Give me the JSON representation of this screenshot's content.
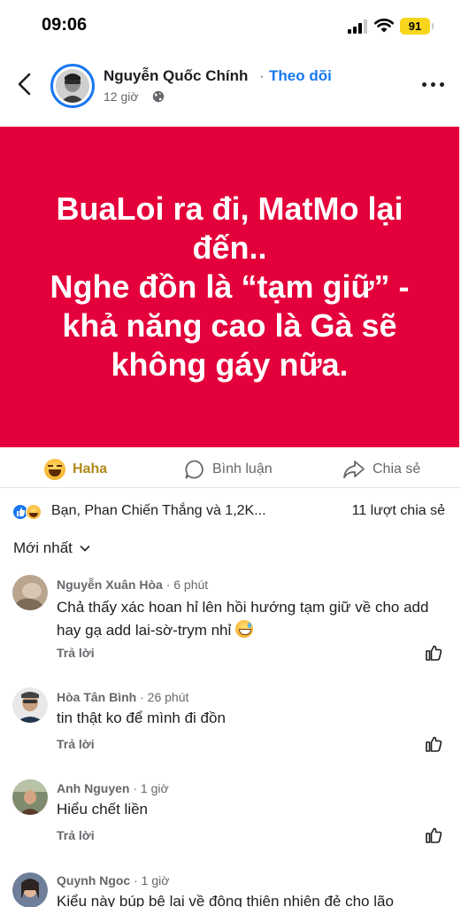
{
  "status_bar": {
    "time": "09:06",
    "battery": "91"
  },
  "post": {
    "author": "Nguyễn Quốc Chính",
    "separator": "·",
    "follow": "Theo dõi",
    "time": "12 giờ",
    "text": "BuaLoi  ra đi, MatMo lại đến..\nNghe đồn là “tạm giữ” - khả năng cao là Gà sẽ không gáy nữa.",
    "card_color": "#e4003a"
  },
  "actions": {
    "haha": "Haha",
    "comment": "Bình luận",
    "share": "Chia sẻ"
  },
  "reactions": {
    "summary": "Bạn, Phan Chiến Thắng và 1,2K...",
    "shares": "11 lượt chia sẻ"
  },
  "sort": {
    "label": "Mới nhất"
  },
  "comments": [
    {
      "name": "Nguyễn Xuân Hòa",
      "time": "· 6 phút",
      "text": "Chả thấy xác hoan hỉ lên hồi hướng tạm giữ về cho add hay gạ add lai-sờ-trym nhỉ",
      "reply": "Trả lời",
      "emoji": "grinning-sweat-icon"
    },
    {
      "name": "Hòa Tân Bình",
      "time": "· 26 phút",
      "text": "tin thật ko để mình đi đồn",
      "reply": "Trả lời"
    },
    {
      "name": "Anh Nguyen",
      "time": "· 1 giờ",
      "text": "Hiểu chết liền",
      "reply": "Trả lời"
    },
    {
      "name": "Quynh Ngoc",
      "time": "· 1 giờ",
      "text": "Kiểu này búp bê lại về động thiên nhiên đẻ cho lão"
    }
  ],
  "colors": {
    "accent": "#1877f2",
    "text": "#1c1e21",
    "muted": "#65676b",
    "haha": "#b0891b"
  }
}
